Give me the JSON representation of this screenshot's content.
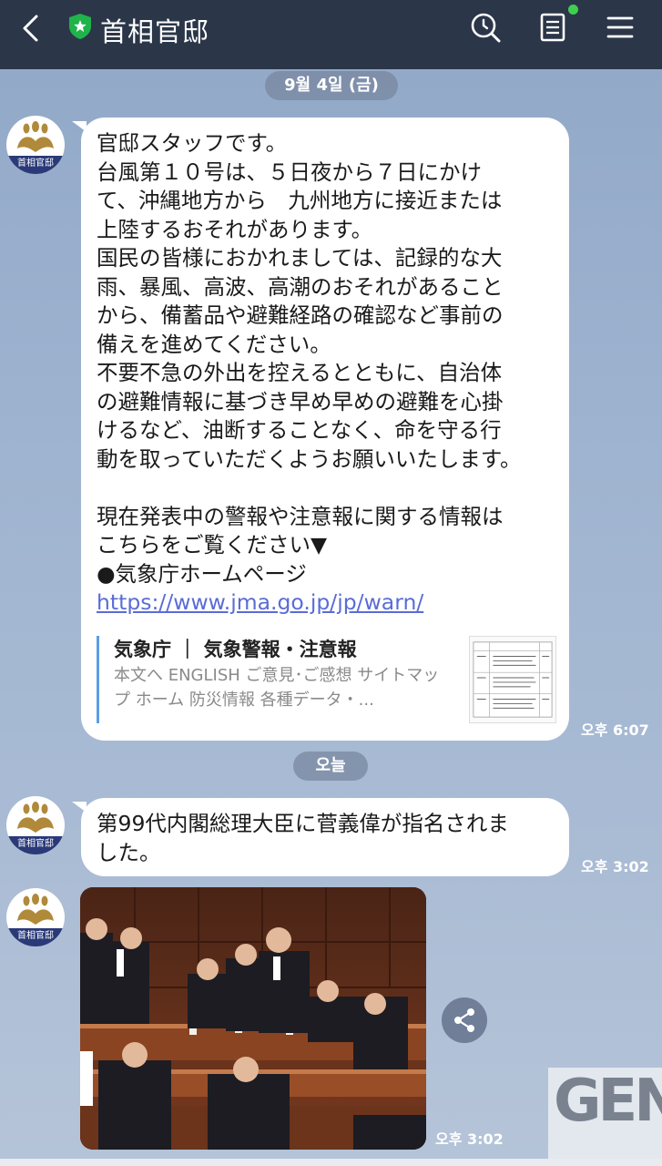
{
  "header": {
    "title": "首相官邸",
    "colors": {
      "bar": "#2b3649",
      "shield": "#1fb34a",
      "notification": "#3ecf4f"
    }
  },
  "dates": {
    "first": "9월 4일 (금)",
    "today": "오늘"
  },
  "avatar": {
    "label": "首相官邸"
  },
  "messages": [
    {
      "lines": [
        "官邸スタッフです。",
        "台風第１０号は、５日夜から７日にかけ",
        "て、沖縄地方から　九州地方に接近または",
        "上陸するおそれがあります。",
        "国民の皆様におかれましては、記録的な大",
        "雨、暴風、高波、高潮のおそれがあること",
        "から、備蓄品や避難経路の確認など事前の",
        "備えを進めてください。",
        "不要不急の外出を控えるとともに、自治体",
        "の避難情報に基づき早め早めの避難を心掛",
        "けるなど、油断することなく、命を守る行",
        "動を取っていただくようお願いいたします。",
        "",
        "現在発表中の警報や注意報に関する情報は",
        "こちらをご覧ください▼",
        "●気象庁ホームページ"
      ],
      "link": "https://www.jma.go.jp/jp/warn/",
      "preview": {
        "title": "気象庁 ｜ 気象警報・注意報",
        "description": "本文へ ENGLISH ご意見･ご感想 サイトマップ ホーム 防災情報 各種データ・..."
      },
      "time": "오후 6:07"
    },
    {
      "lines": [
        "第99代内閣総理大臣に菅義偉が指名されま",
        "した。"
      ],
      "time": "오후 3:02"
    },
    {
      "type": "photo",
      "time": "오후 3:02"
    }
  ],
  "watermark": {
    "text": "GEN"
  },
  "icons": [
    "back-icon",
    "shield-icon",
    "search-icon",
    "notes-icon",
    "menu-icon",
    "share-icon"
  ]
}
